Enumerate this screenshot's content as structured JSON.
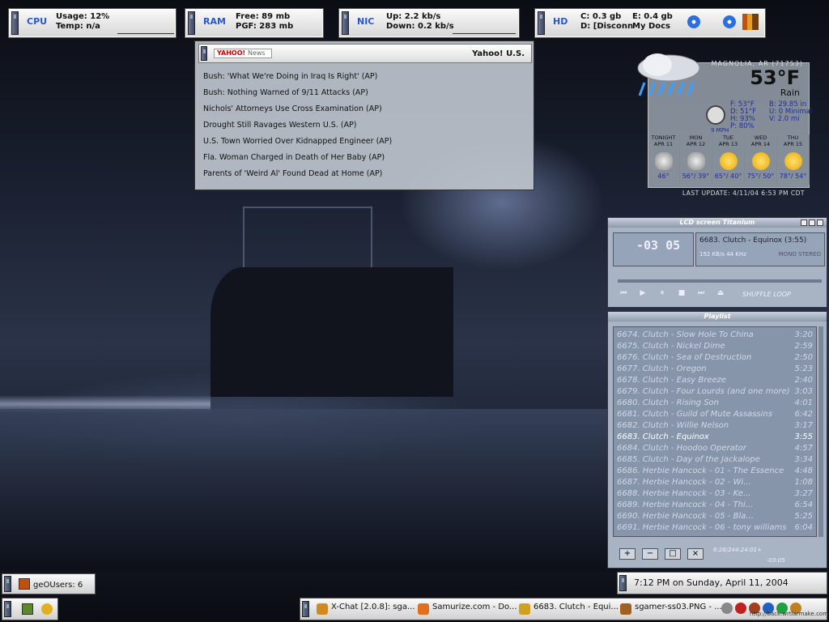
{
  "meters": {
    "cpu": {
      "label": "CPU",
      "line1": "Usage: 12%",
      "line2": "Temp: n/a"
    },
    "ram": {
      "label": "RAM",
      "line1": "Free: 89 mb",
      "line2": "PGF: 283 mb"
    },
    "nic": {
      "label": "NIC",
      "line1": "Up: 2.2 kb/s",
      "line2": "Down: 0.2 kb/s"
    },
    "hd": {
      "label": "HD",
      "line1a": "C: 0.3 gb",
      "line1b": "E: 0.4 gb",
      "line2a": "D: [Disconn",
      "line2b": "My Docs"
    }
  },
  "news": {
    "logo": "YAHOO!",
    "logo_sub": "News",
    "title": "Yahoo! U.S.",
    "items": [
      "Bush: 'What We're Doing in Iraq Is Right' (AP)",
      "Bush: Nothing Warned of 9/11 Attacks (AP)",
      "Nichols' Attorneys Use Cross Examination (AP)",
      "Drought Still Ravages Western U.S. (AP)",
      "U.S. Town Worried Over Kidnapped Engineer (AP)",
      "Fla. Woman Charged in Death of Her Baby (AP)",
      "Parents of 'Weird Al' Found Dead at Home (AP)"
    ]
  },
  "weather": {
    "location": "MAGNOLIA, AR (71753)",
    "temp": "53°F",
    "condition": "Rain",
    "stats_left": [
      "F: 53°F",
      "D: 51°F",
      "H: 93%",
      "P: 80%"
    ],
    "stats_right": [
      "B: 29.85 in",
      "U: 0 Minimal",
      "V: 2.0 mi"
    ],
    "wind": "9 MPH",
    "forecast": [
      {
        "day": "TONIGHT",
        "date": "APR 11",
        "icon": "cloud",
        "temps": "46°"
      },
      {
        "day": "MON",
        "date": "APR 12",
        "icon": "cloud",
        "temps": "56°/ 39°"
      },
      {
        "day": "TUE",
        "date": "APR 13",
        "icon": "sun",
        "temps": "65°/ 40°"
      },
      {
        "day": "WED",
        "date": "APR 14",
        "icon": "sun",
        "temps": "75°/ 50°"
      },
      {
        "day": "THU",
        "date": "APR 15",
        "icon": "sun",
        "temps": "78°/ 54°"
      }
    ],
    "last_update": "LAST UPDATE: 4/11/04 6:53 PM CDT"
  },
  "winamp": {
    "title": "LCD screen Titanium",
    "time": "-03 05",
    "song": "6683. Clutch - Equinox (3:55)",
    "bitrate": "192 KB/s  44 KHz",
    "mode": "MONO STEREO",
    "shuffle": "SHUFFLE",
    "loop": "LOOP"
  },
  "playlist": {
    "title": "Playlist",
    "items": [
      {
        "name": "6674. Clutch - Slow Hole To China",
        "time": "3:20"
      },
      {
        "name": "6675. Clutch - Nickel Dime",
        "time": "2:59"
      },
      {
        "name": "6676. Clutch - Sea of Destruction",
        "time": "2:50"
      },
      {
        "name": "6677. Clutch - Oregon",
        "time": "5:23"
      },
      {
        "name": "6678. Clutch - Easy Breeze",
        "time": "2:40"
      },
      {
        "name": "6679. Clutch - Four Lourds (and one more)",
        "time": "3:03"
      },
      {
        "name": "6680. Clutch - Rising Son",
        "time": "4:01"
      },
      {
        "name": "6681. Clutch - Guild of Mute Assassins",
        "time": "6:42"
      },
      {
        "name": "6682. Clutch - Willie Nelson",
        "time": "3:17"
      },
      {
        "name": "6683. Clutch - Equinox",
        "time": "3:55"
      },
      {
        "name": "6684. Clutch - Hoodoo Operator",
        "time": "4:57"
      },
      {
        "name": "6685. Clutch - Day of the Jackalope",
        "time": "3:34"
      },
      {
        "name": "6686. Herbie Hancock - 01 - The Essence",
        "time": "4:48"
      },
      {
        "name": "6687. Herbie Hancock        - 02 - Wi...",
        "time": "1:08"
      },
      {
        "name": "6688. Herbie Hancock        - 03 - Ke...",
        "time": "3:27"
      },
      {
        "name": "6689. Herbie Hancock        - 04 - Thi...",
        "time": "6:54"
      },
      {
        "name": "6690. Herbie Hancock        - 05 - Bla...",
        "time": "5:25"
      },
      {
        "name": "6691. Herbie Hancock - 06 - tony williams",
        "time": "6:04"
      }
    ],
    "current_index": 9,
    "total_time": "6:28/244:24:01+",
    "elapsed": "-03:05",
    "buttons": [
      "+",
      "−",
      "□",
      "×"
    ]
  },
  "clock": {
    "text": "7:12 PM on Sunday, April 11, 2004"
  },
  "geo": {
    "text": "geOUsers: 6"
  },
  "taskbar": {
    "tasks": [
      {
        "label": "X-Chat [2.0.8]: sga...",
        "color": "#d08a20"
      },
      {
        "label": "Samurize.com - Do...",
        "color": "#e07020"
      },
      {
        "label": "6683. Clutch - Equi...",
        "color": "#d0a020"
      },
      {
        "label": "sgamer-ss03.PNG - ...",
        "color": "#a06020"
      }
    ],
    "tray_url": "http://back.wrtlarmake.com"
  },
  "colors": {
    "accent": "#2a57c9",
    "panel": "#a8b4c4"
  }
}
